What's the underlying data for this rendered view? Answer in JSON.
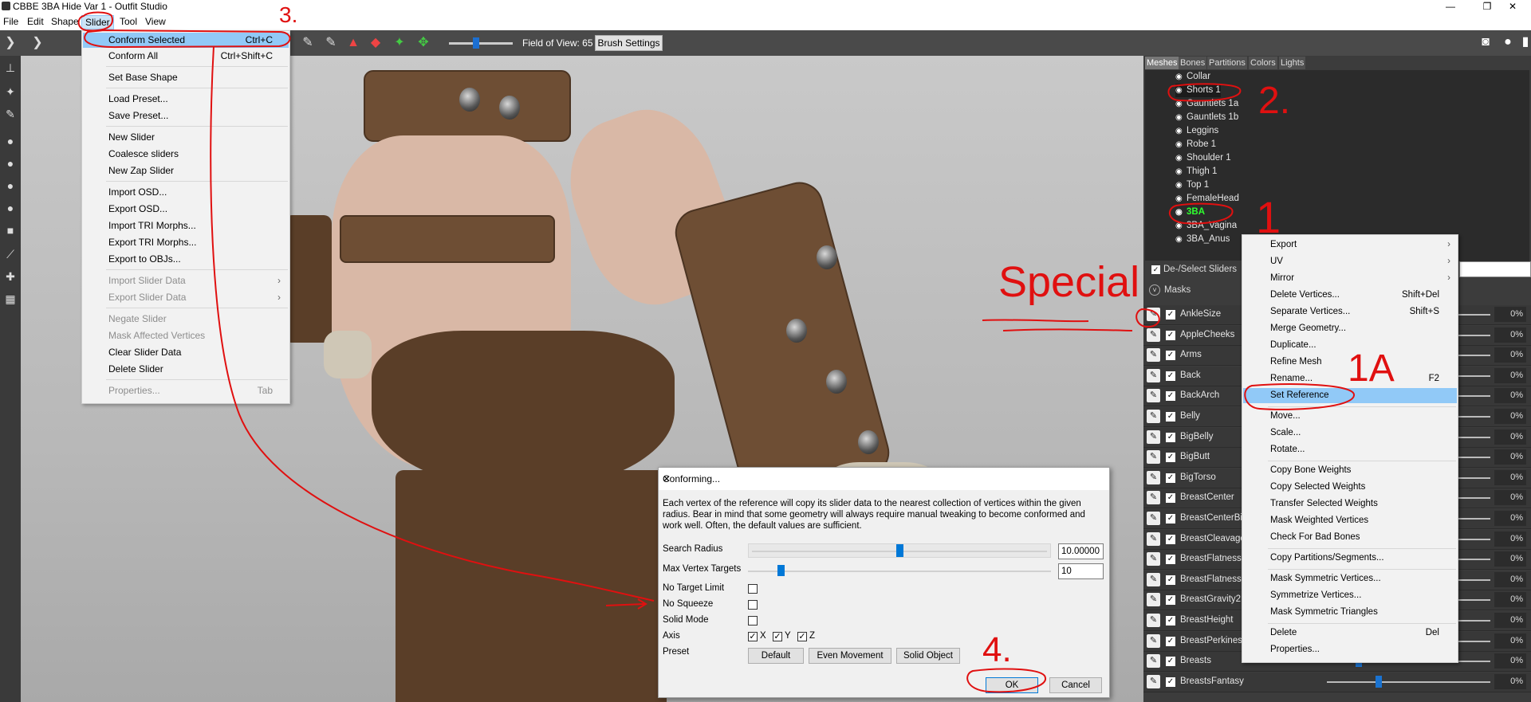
{
  "window": {
    "title": "CBBE 3BA Hide Var 1 - Outfit Studio",
    "minimize": "—",
    "restore": "❐",
    "close": "✕"
  },
  "menubar": [
    "File",
    "Edit",
    "Shape",
    "Slider",
    "Tool",
    "View"
  ],
  "toolbar": {
    "fov_label": "Field of View: 65",
    "brush_settings": "Brush Settings"
  },
  "slider_menu": [
    {
      "label": "Conform Selected",
      "shortcut": "Ctrl+C"
    },
    {
      "label": "Conform All",
      "shortcut": "Ctrl+Shift+C"
    },
    {
      "label": "Set Base Shape",
      "shortcut": ""
    },
    {
      "label": "Load Preset...",
      "shortcut": ""
    },
    {
      "label": "Save Preset...",
      "shortcut": ""
    },
    {
      "label": "New Slider",
      "shortcut": ""
    },
    {
      "label": "Coalesce sliders",
      "shortcut": ""
    },
    {
      "label": "New Zap Slider",
      "shortcut": ""
    },
    {
      "label": "Import OSD...",
      "shortcut": ""
    },
    {
      "label": "Export OSD...",
      "shortcut": ""
    },
    {
      "label": "Import TRI Morphs...",
      "shortcut": ""
    },
    {
      "label": "Export TRI Morphs...",
      "shortcut": ""
    },
    {
      "label": "Export to OBJs...",
      "shortcut": ""
    },
    {
      "label": "Import Slider Data",
      "shortcut": ""
    },
    {
      "label": "Export Slider Data",
      "shortcut": ""
    },
    {
      "label": "Negate Slider",
      "shortcut": ""
    },
    {
      "label": "Mask Affected Vertices",
      "shortcut": ""
    },
    {
      "label": "Clear Slider Data",
      "shortcut": ""
    },
    {
      "label": "Delete Slider",
      "shortcut": ""
    },
    {
      "label": "Properties...",
      "shortcut": "Tab"
    }
  ],
  "dialog": {
    "title": "Conforming...",
    "close": "✕",
    "description": "Each vertex of the reference will copy its slider data to the nearest collection of vertices within the given radius. Bear in mind that some geometry will always require manual tweaking to become conformed and work well. Often, the default values are sufficient.",
    "search_radius_label": "Search Radius",
    "search_radius_value": "10.00000",
    "search_radius_level": 0.5,
    "max_vertex_label": "Max Vertex Targets",
    "max_vertex_value": "10",
    "no_target_limit": "No Target Limit",
    "no_squeeze": "No Squeeze",
    "solid_mode": "Solid Mode",
    "axis_label": "Axis",
    "axis_x": "X",
    "axis_y": "Y",
    "axis_z": "Z",
    "preset_label": "Preset",
    "preset_default": "Default",
    "preset_even": "Even Movement",
    "preset_solid": "Solid Object",
    "ok": "OK",
    "cancel": "Cancel"
  },
  "right_panel": {
    "tabs": [
      "Meshes",
      "Bones",
      "Partitions",
      "Colors",
      "Lights"
    ],
    "meshes": [
      "Collar",
      "Shorts 1",
      "Gauntlets 1a",
      "Gauntlets 1b",
      "Leggins",
      "Robe 1",
      "Shoulder 1",
      "Thigh 1",
      "Top 1",
      "FemaleHead",
      "3BA",
      "3BA_Vagina",
      "3BA_Anus"
    ],
    "deselect": "De-/Select Sliders",
    "masks": "Masks",
    "sliders": [
      "AnkleSize",
      "AppleCheeks",
      "Arms",
      "Back",
      "BackArch",
      "Belly",
      "BigBelly",
      "BigButt",
      "BigTorso",
      "BreastCenter",
      "BreastCenterBig",
      "BreastCleavage",
      "BreastFlatness2",
      "BreastFlatness",
      "BreastGravity2",
      "BreastHeight",
      "BreastPerkiness",
      "Breasts",
      "BreastsFantasy"
    ],
    "slider_value": "0%"
  },
  "context_menu": [
    {
      "label": "Export",
      "shortcut": "",
      "sub": true
    },
    {
      "label": "UV",
      "shortcut": "",
      "sub": true
    },
    {
      "label": "Mirror",
      "shortcut": "",
      "sub": true
    },
    {
      "label": "Delete Vertices...",
      "shortcut": "Shift+Del"
    },
    {
      "label": "Separate Vertices...",
      "shortcut": "Shift+S"
    },
    {
      "label": "Merge Geometry...",
      "shortcut": ""
    },
    {
      "label": "Duplicate...",
      "shortcut": ""
    },
    {
      "label": "Refine Mesh",
      "shortcut": ""
    },
    {
      "label": "Rename...",
      "shortcut": "F2"
    },
    {
      "label": "Set Reference",
      "shortcut": ""
    },
    {
      "label": "Move...",
      "shortcut": ""
    },
    {
      "label": "Scale...",
      "shortcut": ""
    },
    {
      "label": "Rotate...",
      "shortcut": ""
    },
    {
      "label": "Copy Bone Weights",
      "shortcut": ""
    },
    {
      "label": "Copy Selected Weights",
      "shortcut": ""
    },
    {
      "label": "Transfer Selected Weights",
      "shortcut": ""
    },
    {
      "label": "Mask Weighted Vertices",
      "shortcut": ""
    },
    {
      "label": "Check For Bad Bones",
      "shortcut": ""
    },
    {
      "label": "Copy Partitions/Segments...",
      "shortcut": ""
    },
    {
      "label": "Mask Symmetric Vertices...",
      "shortcut": ""
    },
    {
      "label": "Symmetrize Vertices...",
      "shortcut": ""
    },
    {
      "label": "Mask Symmetric Triangles",
      "shortcut": ""
    },
    {
      "label": "Delete",
      "shortcut": "Del"
    },
    {
      "label": "Properties...",
      "shortcut": ""
    }
  ],
  "annotations": {
    "n1": "1",
    "n2": "2.",
    "n3": "3.",
    "n4": "4.",
    "n1a": "1A",
    "special": "Special"
  }
}
